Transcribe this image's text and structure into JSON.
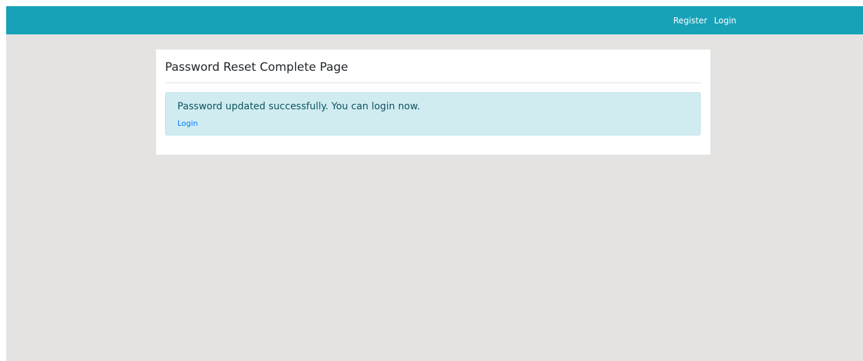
{
  "navbar": {
    "links": [
      {
        "label": "Register"
      },
      {
        "label": "Login"
      }
    ],
    "color": "#17a2b8"
  },
  "card": {
    "title": "Password Reset Complete Page",
    "alert": {
      "message": "Password updated successfully. You can login now.",
      "link_label": "Login",
      "background": "#d1ecf1"
    }
  }
}
